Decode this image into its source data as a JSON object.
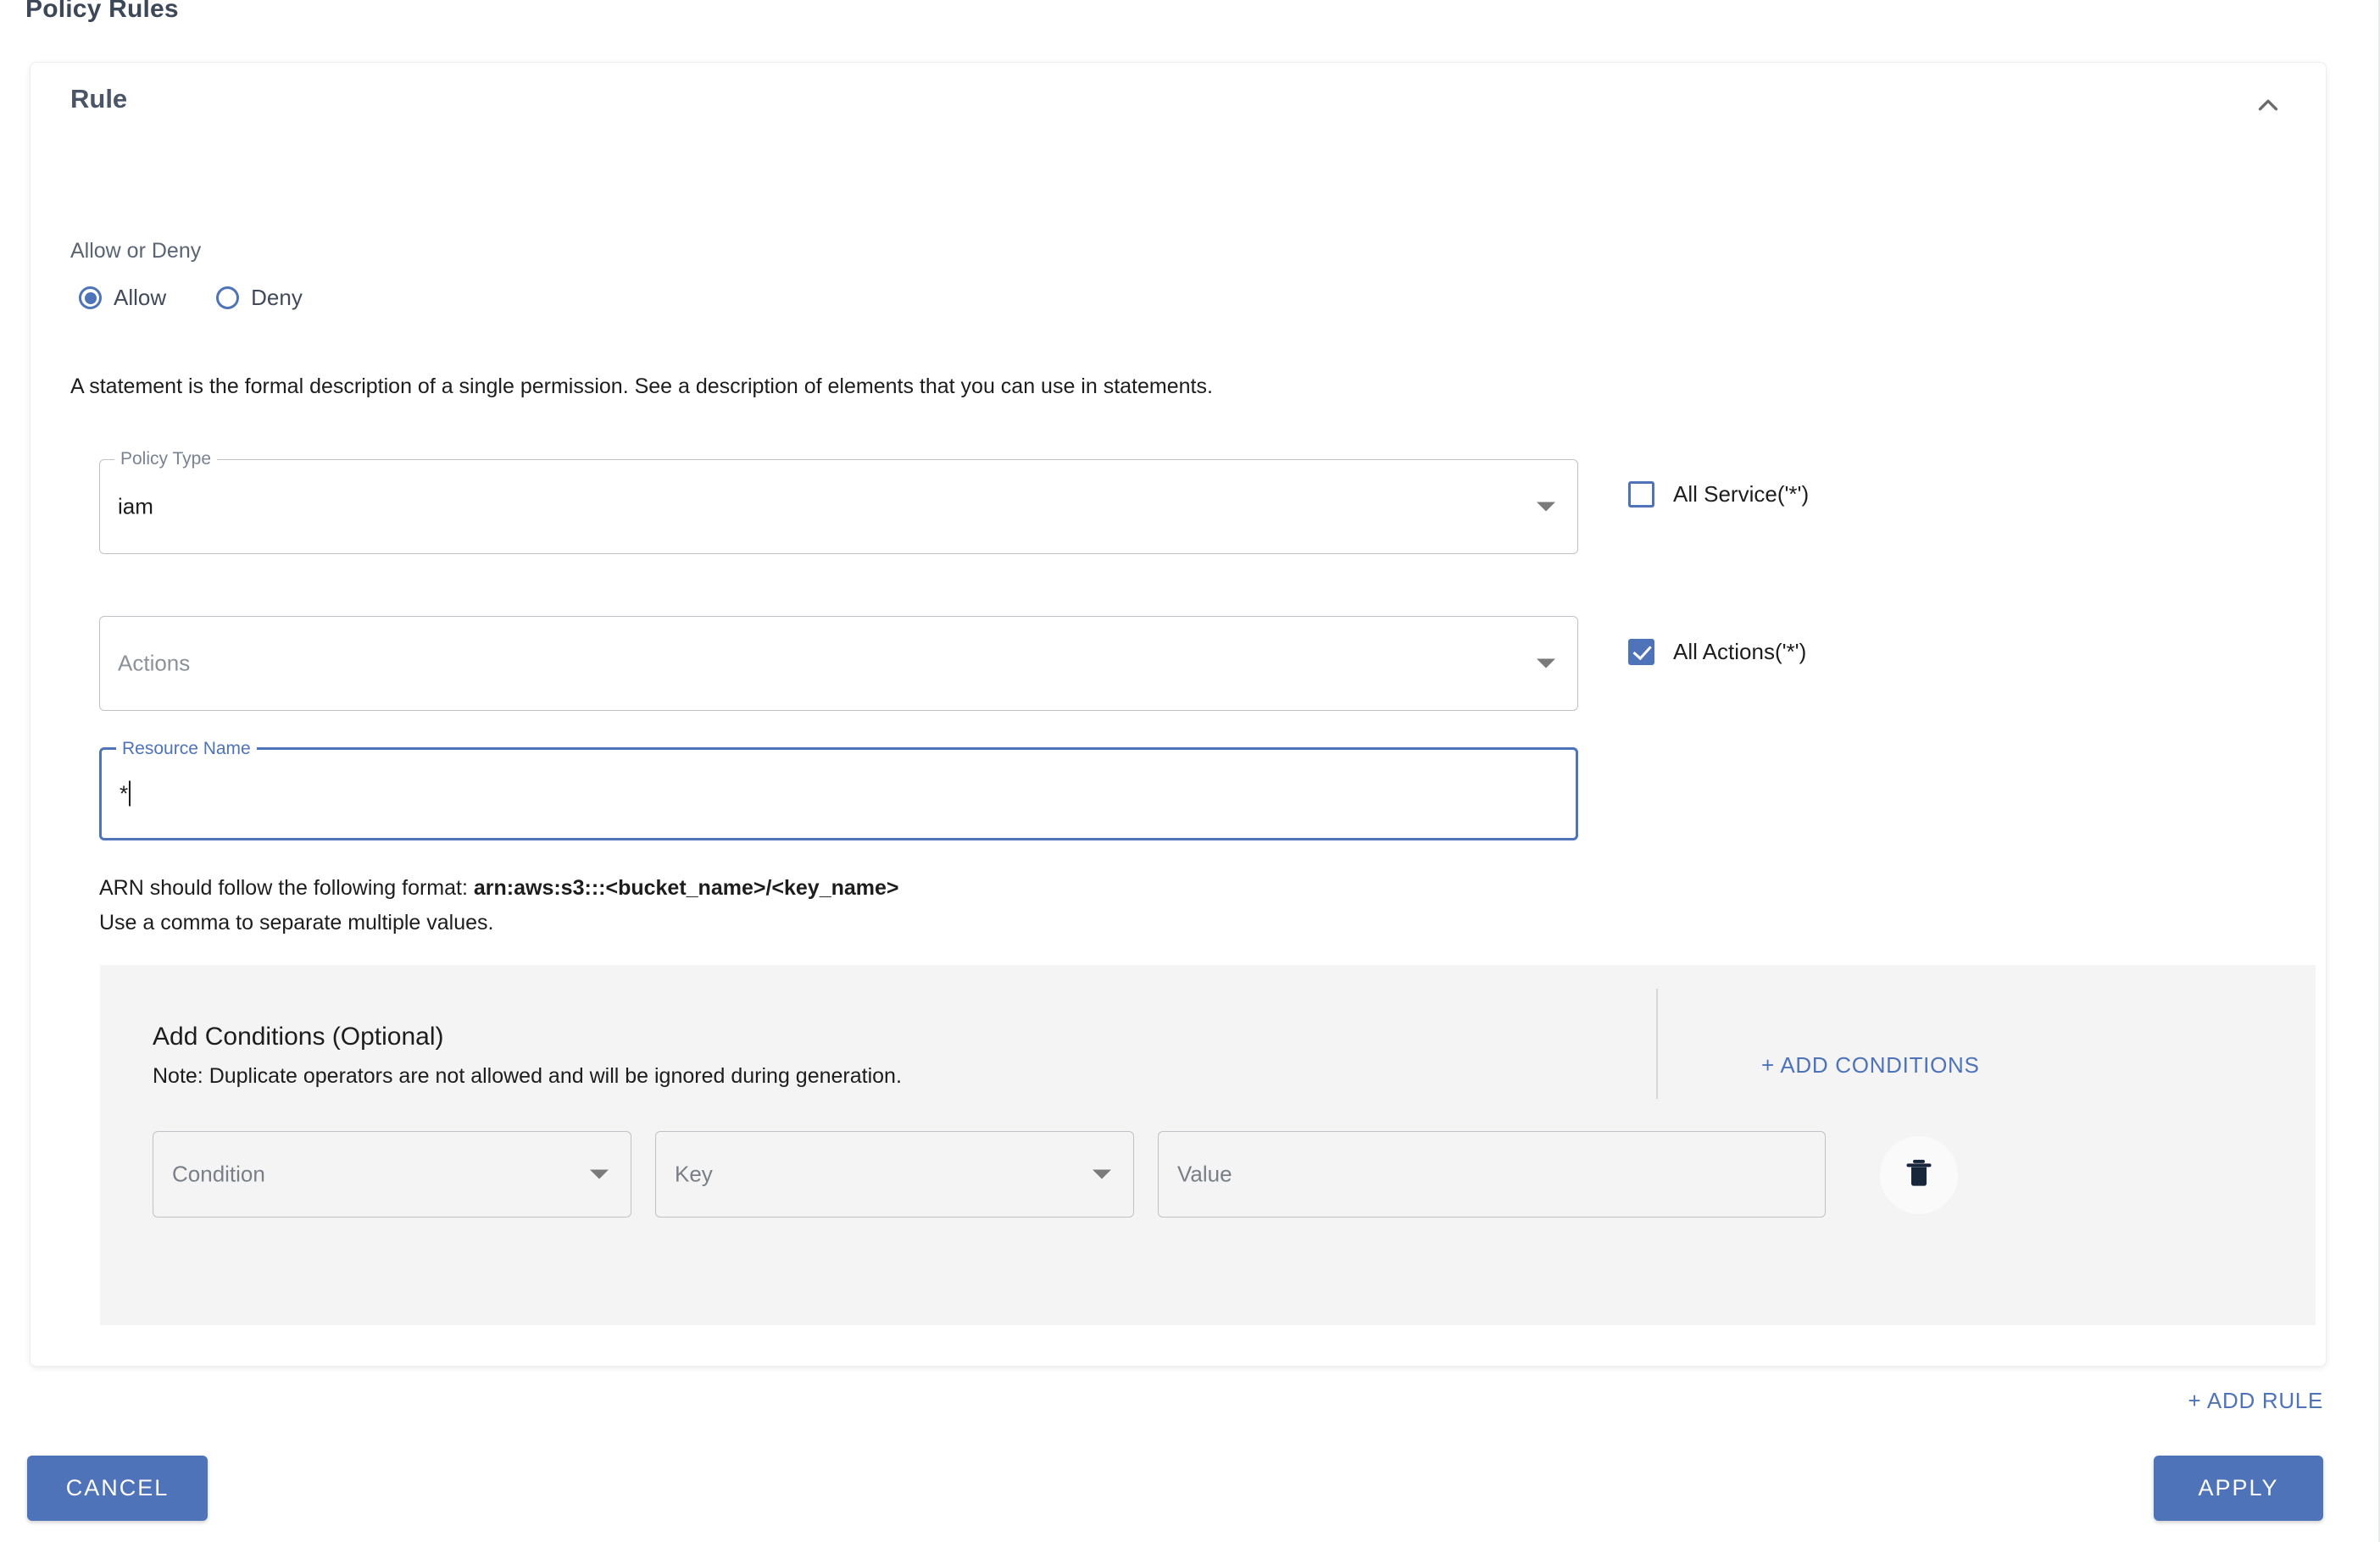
{
  "page": {
    "section_title": "Policy Rules"
  },
  "rule": {
    "title": "Rule",
    "collapse_icon": "chevron-up-icon",
    "allow_deny_label": "Allow or Deny",
    "radio_options": [
      {
        "label": "Allow",
        "checked": true
      },
      {
        "label": "Deny",
        "checked": false
      }
    ],
    "statement_text": "A statement is the formal description of a single permission. See a description of elements that you can use in statements.",
    "policy_type": {
      "legend": "Policy Type",
      "value": "iam",
      "dropdown_icon": "triangle-down-icon"
    },
    "actions": {
      "placeholder": "Actions",
      "value": "",
      "dropdown_icon": "triangle-down-icon"
    },
    "resource_name": {
      "legend": "Resource Name",
      "value": "*",
      "focused": true
    },
    "all_service": {
      "label": "All Service('*')",
      "checked": false
    },
    "all_actions": {
      "label": "All Actions('*')",
      "checked": true
    },
    "arn_help": {
      "line1_prefix": "ARN should follow the following format: ",
      "line1_format": "arn:aws:s3:::<bucket_name>/<key_name>",
      "line2": "Use a comma to separate multiple values."
    },
    "conditions": {
      "title": "Add Conditions (Optional)",
      "note": "Note: Duplicate operators are not allowed and will be ignored during generation.",
      "add_button": "+ ADD CONDITIONS",
      "row": {
        "condition_placeholder": "Condition",
        "key_placeholder": "Key",
        "value_placeholder": "Value",
        "delete_icon": "trash-icon"
      }
    }
  },
  "footer": {
    "add_rule": "+ ADD RULE",
    "cancel": "CANCEL",
    "apply": "APPLY"
  },
  "colors": {
    "accent": "#4e73b8",
    "panel_bg": "#f4f4f4",
    "text": "#1d1d1d",
    "muted": "#7a7f87"
  }
}
